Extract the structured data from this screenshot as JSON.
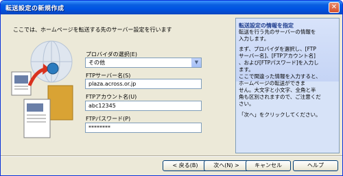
{
  "window": {
    "title": "転送設定の新規作成",
    "close_glyph": "✕"
  },
  "intro": "ここでは、ホームページを転送する先のサーバー設定を行います",
  "fields": {
    "provider": {
      "label": "プロバイダの選択(E)",
      "value": "その他"
    },
    "ftp_server": {
      "label": "FTPサーバー名(S)",
      "value": "plaza.across.or.jp"
    },
    "ftp_account": {
      "label": "FTPアカウント名(U)",
      "value": "abc12345"
    },
    "ftp_password": {
      "label": "FTPパスワード(P)",
      "value": "********"
    }
  },
  "info": {
    "title": "転送設定の情報を指定",
    "line1": "転送を行う先のサーバーの情報を\n入力します。",
    "line2": "まず、プロバイダを選択し、[FTP\nサーバー名]、[FTPアカウント名]\n、および[FTPパスワード]を入力し\nます。\nここで間違った情報を入力すると、\nホームページの転送ができま\nせん。大文字と小文字、全角と半\n角も区別されますので、ご注意くだ\nさい。",
    "line3": "「次へ」をクリックしてください。"
  },
  "buttons": {
    "back": "< 戻る(B)",
    "next": "次へ(N) >",
    "cancel": "キャンセル",
    "help": "ヘルプ"
  },
  "colors": {
    "title_bar": "#0054e3",
    "dialog_bg": "#ece9d8",
    "info_bg": "#d7e3f8"
  }
}
